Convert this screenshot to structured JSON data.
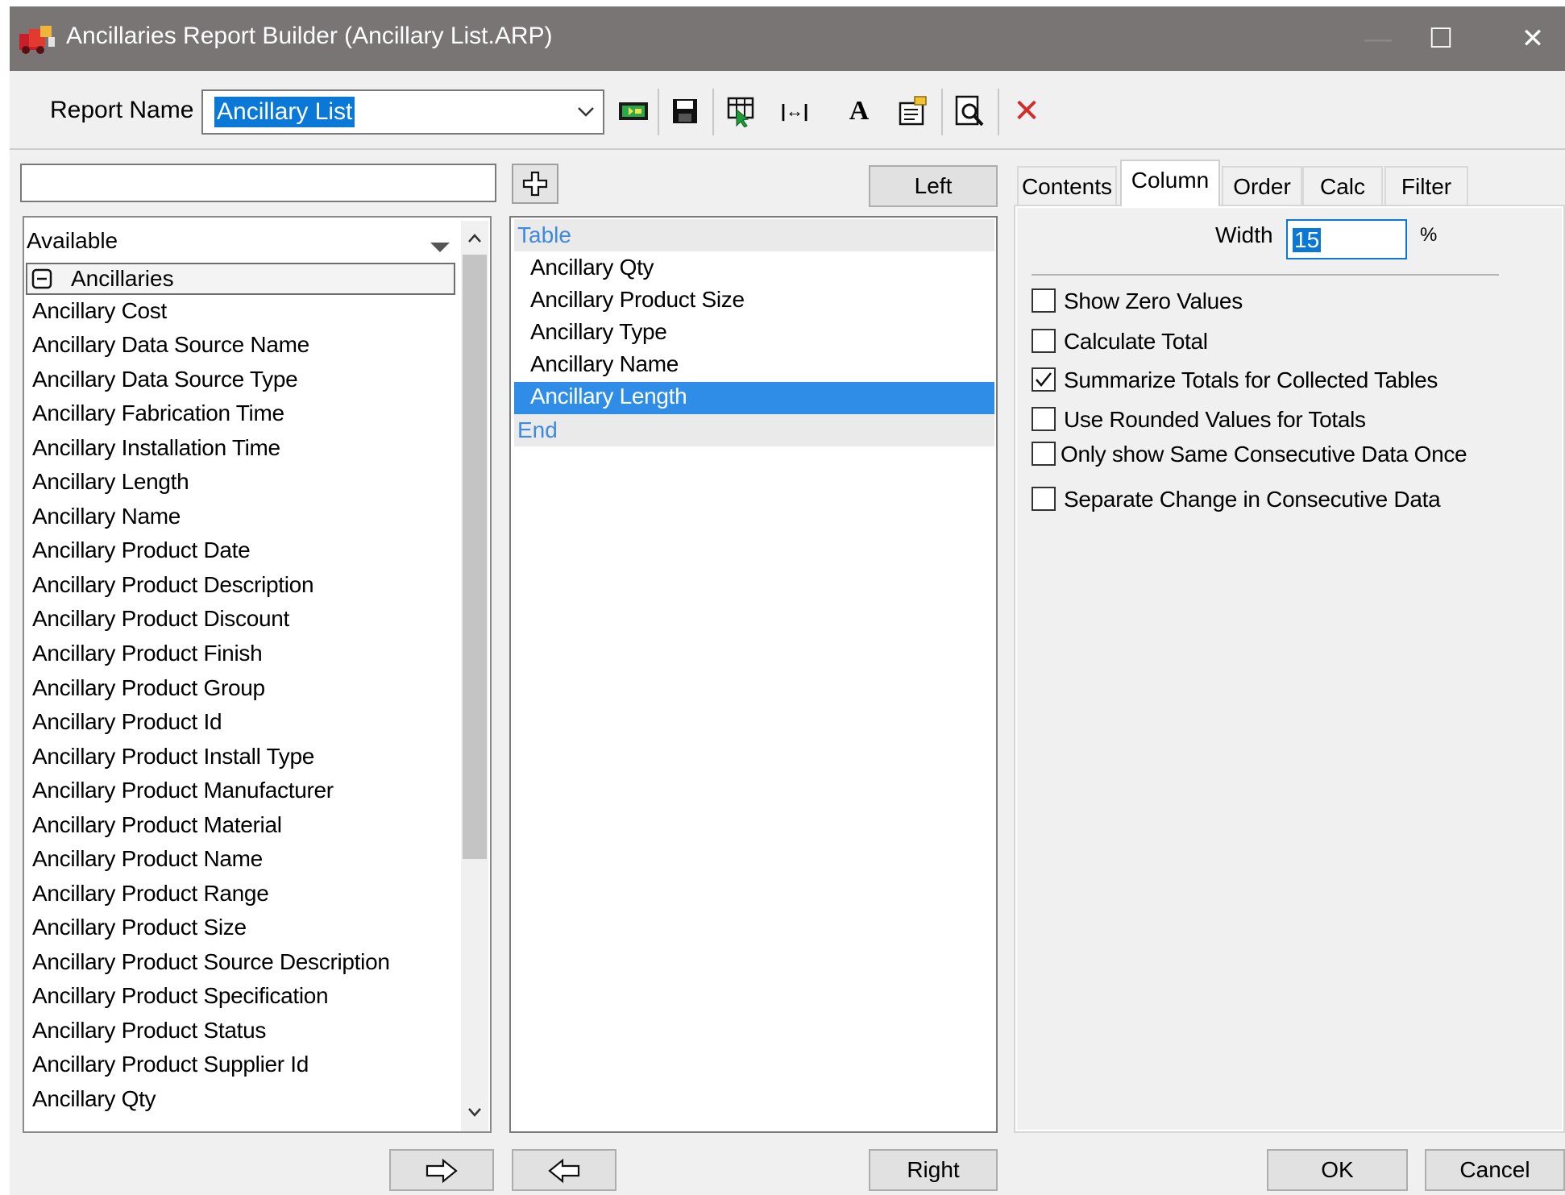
{
  "window": {
    "title": "Ancillaries Report Builder (Ancillary List.ARP)",
    "minimize_glyph": "—",
    "maximize_glyph": "☐",
    "close_glyph": "✕"
  },
  "toolbar": {
    "report_name_label": "Report Name",
    "report_name_value": "Ancillary List",
    "icons": [
      "new-report-icon",
      "save-icon",
      "select-columns-icon",
      "column-width-icon",
      "font-icon",
      "properties-icon",
      "print-preview-icon",
      "delete-icon"
    ],
    "width_icon_glyph": "|↔|",
    "font_glyph": "A",
    "delete_glyph": "✕",
    "delete_color": "#d52a2a"
  },
  "available": {
    "header": "Available",
    "group_label": "Ancillaries",
    "items": [
      "Ancillary Cost",
      "Ancillary Data Source Name",
      "Ancillary Data Source Type",
      "Ancillary Fabrication Time",
      "Ancillary Installation Time",
      "Ancillary Length",
      "Ancillary Name",
      "Ancillary Product Date",
      "Ancillary Product Description",
      "Ancillary Product Discount",
      "Ancillary Product Finish",
      "Ancillary Product Group",
      "Ancillary Product Id",
      "Ancillary Product Install Type",
      "Ancillary Product Manufacturer",
      "Ancillary Product Material",
      "Ancillary Product Name",
      "Ancillary Product Range",
      "Ancillary Product Size",
      "Ancillary Product Source Description",
      "Ancillary Product Specification",
      "Ancillary Product Status",
      "Ancillary Product Supplier Id",
      "Ancillary Qty"
    ]
  },
  "columns": {
    "header_table": "Table",
    "header_end": "End",
    "items": [
      "Ancillary Qty",
      "Ancillary Product Size",
      "Ancillary Type",
      "Ancillary Name",
      "Ancillary Length"
    ],
    "selected": "Ancillary Length",
    "header_color": "#3d8be0",
    "selection_color": "#2f8de8"
  },
  "buttons": {
    "left": "Left",
    "right": "Right",
    "ok": "OK",
    "cancel": "Cancel",
    "add_glyph": "✚",
    "arrow_right_glyph": "⇨",
    "arrow_left_glyph": "⇦"
  },
  "tabs": [
    {
      "label": "Contents"
    },
    {
      "label": "Column",
      "active": true
    },
    {
      "label": "Order"
    },
    {
      "label": "Calc"
    },
    {
      "label": "Filter"
    }
  ],
  "column_panel": {
    "width_label": "Width",
    "width_value": "15",
    "width_unit": "%",
    "options": [
      {
        "label": "Show Zero Values",
        "checked": false
      },
      {
        "label": "Calculate Total",
        "checked": false
      },
      {
        "label": "Summarize Totals for Collected Tables",
        "checked": true
      },
      {
        "label": "Use Rounded Values for Totals",
        "checked": false
      },
      {
        "label": "Only show Same Consecutive Data Once",
        "checked": false
      },
      {
        "label": "Separate Change in Consecutive Data",
        "checked": false
      }
    ]
  }
}
